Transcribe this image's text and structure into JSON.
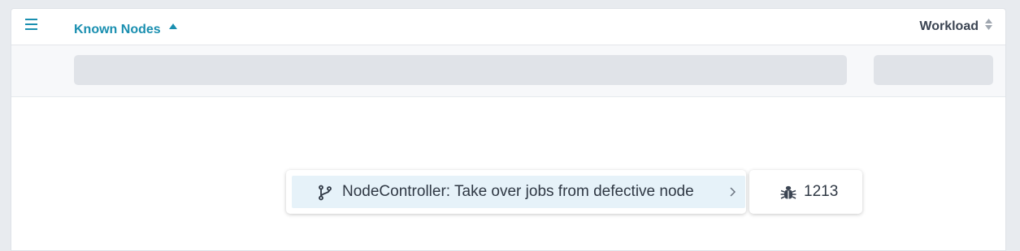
{
  "header": {
    "menu_icon": "hamburger-menu-icon",
    "columns": [
      {
        "label": "Known Nodes",
        "sort": "ascending",
        "sort_icon": "sort-ascending-icon"
      },
      {
        "label": "Workload",
        "sort": "none",
        "sort_icon": "sort-both-icon"
      }
    ]
  },
  "popup": {
    "item": {
      "icon": "git-branch-icon",
      "label": "NodeController: Take over jobs from defective node",
      "chevron_icon": "chevron-right-icon"
    },
    "count": {
      "icon": "bug-icon",
      "value": "1213"
    }
  },
  "colors": {
    "accent": "#1a8fb0",
    "text": "#2f3844",
    "highlight": "#e6f2f9",
    "skeleton": "#e0e3e8"
  }
}
